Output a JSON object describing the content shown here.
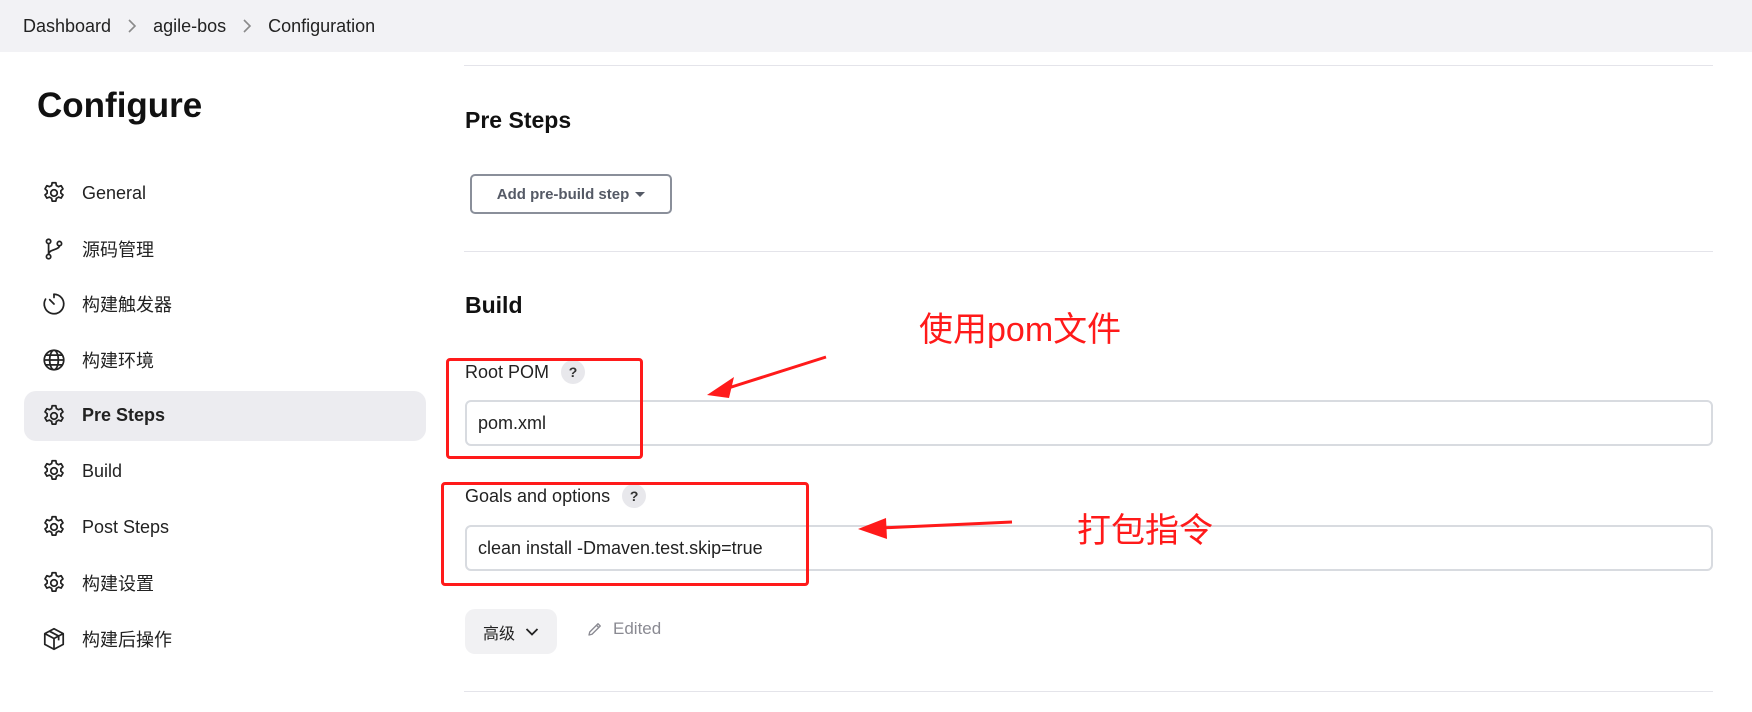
{
  "breadcrumb": [
    "Dashboard",
    "agile-bos",
    "Configuration"
  ],
  "sidebar": {
    "title": "Configure",
    "items": [
      {
        "label": "General",
        "icon": "gear-icon",
        "active": false
      },
      {
        "label": "源码管理",
        "icon": "branch-icon",
        "active": false
      },
      {
        "label": "构建触发器",
        "icon": "timer-icon",
        "active": false
      },
      {
        "label": "构建环境",
        "icon": "globe-icon",
        "active": false
      },
      {
        "label": "Pre Steps",
        "icon": "gear-icon",
        "active": true
      },
      {
        "label": "Build",
        "icon": "gear-icon",
        "active": false
      },
      {
        "label": "Post Steps",
        "icon": "gear-icon",
        "active": false
      },
      {
        "label": "构建设置",
        "icon": "gear-icon",
        "active": false
      },
      {
        "label": "构建后操作",
        "icon": "package-icon",
        "active": false
      }
    ]
  },
  "pre_steps": {
    "title": "Pre Steps",
    "add_button_label": "Add pre-build step"
  },
  "build": {
    "title": "Build",
    "root_pom": {
      "label": "Root POM",
      "help": "?",
      "value": "pom.xml"
    },
    "goals": {
      "label": "Goals and options",
      "help": "?",
      "value": "clean install -Dmaven.test.skip=true"
    },
    "advanced_label": "高级",
    "edited_label": "Edited"
  },
  "annotations": {
    "pom_note": "使用pom文件",
    "goals_note": "打包指令",
    "color": "#ff1a1a"
  }
}
